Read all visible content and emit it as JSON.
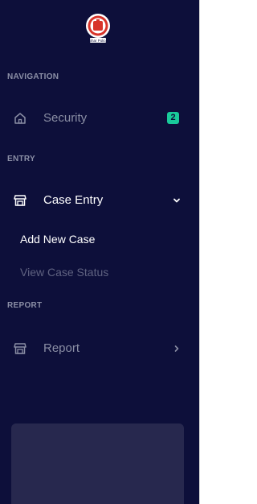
{
  "logo": {
    "icon": "emblem-logo",
    "caption": "Bihar Police"
  },
  "sections": {
    "navigation": "NAVIGATION",
    "entry": "ENTRY",
    "report": "REPORT"
  },
  "nav": {
    "security": {
      "label": "Security",
      "badge": "2",
      "icon": "home-icon"
    },
    "case_entry": {
      "label": "Case Entry",
      "icon": "store-icon",
      "expanded": true
    },
    "report": {
      "label": "Report",
      "icon": "store-icon",
      "expanded": false
    }
  },
  "case_entry_menu": {
    "add_new_case": "Add New Case",
    "view_case_status": "View Case Status"
  },
  "colors": {
    "sidebar_bg": "#0d0f3a",
    "badge": "#19c99a",
    "text_active": "#ffffff",
    "text_dim": "#8a8ea4"
  }
}
